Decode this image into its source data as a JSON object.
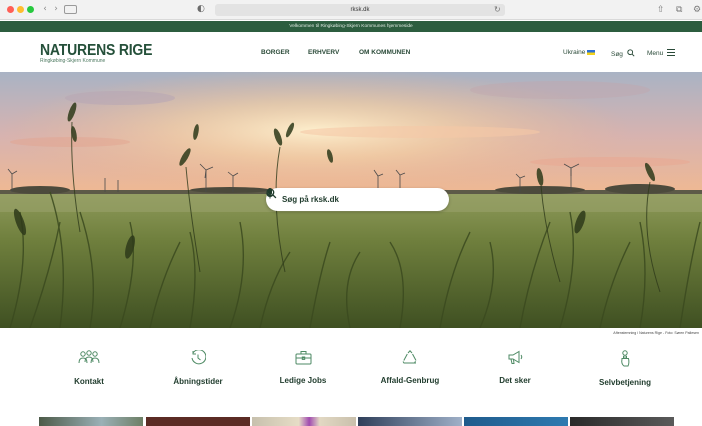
{
  "browser": {
    "url": "rksk.dk",
    "sidebar_glyph": "",
    "shield_glyph": "◐",
    "reload_glyph": "↻",
    "back_glyph": "‹",
    "forward_glyph": "›",
    "share_glyph": "⇧",
    "tabs_glyph": "⧉",
    "more_glyph": "⚙"
  },
  "welcome_text": "Velkommen til Ringkøbing-Skjern Kommunes hjemmeside",
  "logo": {
    "title": "NATURENS RIGE",
    "subtitle": "Ringkøbing-Skjern Kommune"
  },
  "nav": {
    "borger": "BORGER",
    "erhverv": "ERHVERV",
    "kommune": "OM KOMMUNEN"
  },
  "header_right": {
    "language": "Ukraine",
    "search": "Søg",
    "menu": "Menu"
  },
  "hero": {
    "search_placeholder": "Søg på rksk.dk",
    "credit": "Aftenstemning i Naturens Rige - Foto: Søren Pallesen"
  },
  "quick_links": [
    {
      "label": "Kontakt",
      "icon": "people-icon"
    },
    {
      "label": "Åbningstider",
      "icon": "clock-icon"
    },
    {
      "label": "Ledige Jobs",
      "icon": "briefcase-icon"
    },
    {
      "label": "Affald-Genbrug",
      "icon": "recycle-icon"
    },
    {
      "label": "Det sker",
      "icon": "megaphone-icon"
    },
    {
      "label": "Selvbetjening",
      "icon": "hand-icon"
    }
  ],
  "colors": {
    "brand_green": "#25503a",
    "strip_green": "#2c5d3f",
    "icon_green": "#4e8a64"
  }
}
